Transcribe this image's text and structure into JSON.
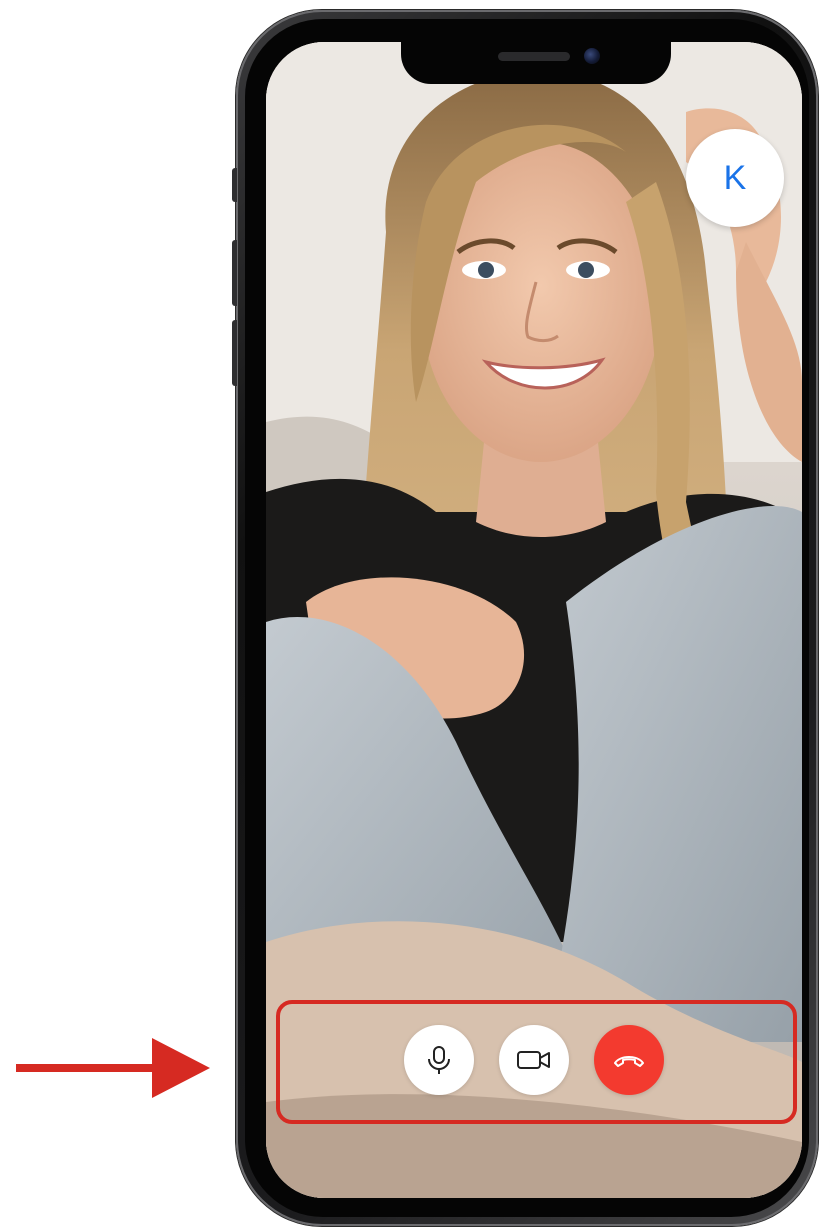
{
  "app": {
    "screen": "video-call"
  },
  "remote_participant": {
    "avatar_initial": "K",
    "avatar_color": "#1a73e8"
  },
  "controls": {
    "microphone": {
      "icon": "microphone-icon"
    },
    "camera": {
      "icon": "video-camera-icon"
    },
    "end_call": {
      "icon": "phone-hangup-icon",
      "color": "#f33a2f"
    }
  },
  "annotation": {
    "highlight_color": "#d62a22",
    "arrow_color": "#d62a22"
  }
}
